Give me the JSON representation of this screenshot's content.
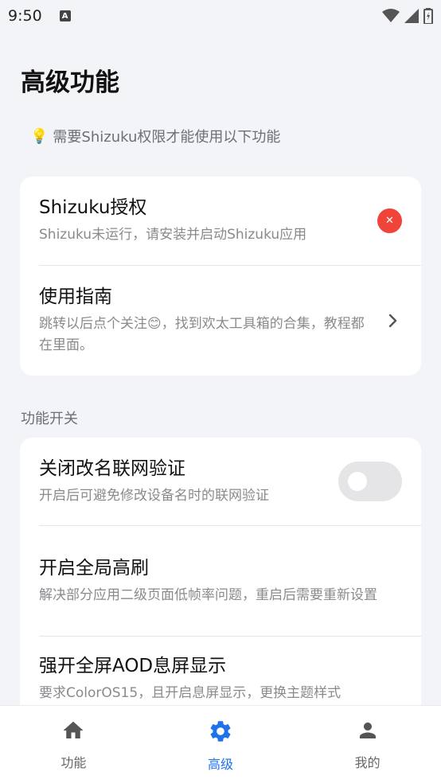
{
  "status_bar": {
    "time": "9:50",
    "notification_badge": "A"
  },
  "page": {
    "title": "高级功能",
    "hint": "需要Shizuku权限才能使用以下功能"
  },
  "shizuku_card": {
    "auth_title": "Shizuku授权",
    "auth_sub": "Shizuku未运行，请安装并启动Shizuku应用",
    "guide_title": "使用指南",
    "guide_sub": "跳转以后点个关注😊，找到欢太工具箱的合集，教程都在里面。"
  },
  "section": {
    "label": "功能开关"
  },
  "features": [
    {
      "title": "关闭改名联网验证",
      "sub": "开启后可避免修改设备名时的联网验证",
      "enabled": false
    },
    {
      "title": "开启全局高刷",
      "sub": "解决部分应用二级页面低帧率问题，重启后需要重新设置"
    },
    {
      "title": "强开全屏AOD息屏显示",
      "sub": "要求ColorOS15，且开启息屏显示，更换主题样式"
    }
  ],
  "bottom_nav": {
    "items": [
      {
        "label": "功能",
        "icon": "home-icon"
      },
      {
        "label": "高级",
        "icon": "gear-icon",
        "active": true
      },
      {
        "label": "我的",
        "icon": "person-icon"
      }
    ]
  },
  "colors": {
    "accent": "#1e73e8",
    "error": "#f0433a",
    "background": "#f3f4f8"
  }
}
